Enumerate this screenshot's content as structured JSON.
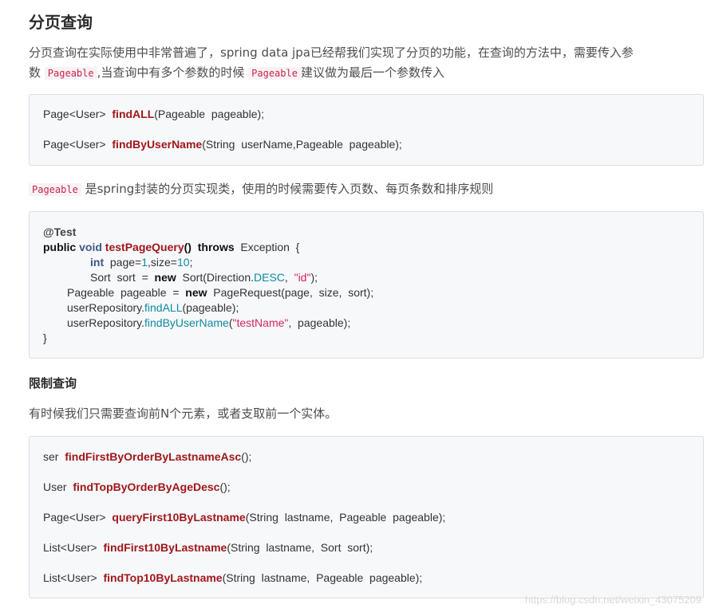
{
  "section1": {
    "title": "分页查询",
    "intro_part1": "分页查询在实际使用中非常普遍了，spring data jpa已经帮我们实现了分页的功能，在查询的方法中，需要传入参",
    "intro_part2_a": "数",
    "intro_code1": "Pageable",
    "intro_part2_b": ",当查询中有多个参数的时候",
    "intro_code2": "Pageable",
    "intro_part2_c": "建议做为最后一个参数传入"
  },
  "code1": {
    "line1": {
      "prefix": "Page<User>  ",
      "method": "findALL",
      "suffix": "(Pageable  pageable);"
    },
    "line2": {
      "prefix": "Page<User>  ",
      "method": "findByUserName",
      "suffix": "(String  userName,Pageable  pageable);"
    }
  },
  "pageable_desc": {
    "code": "Pageable",
    "text": " 是spring封装的分页实现类，使用的时候需要传入页数、每页条数和排序规则"
  },
  "code2": {
    "annotation": "@Test",
    "l2_public": "public",
    "l2_void": "void",
    "l2_method": "testPageQuery",
    "l2_paren": "()  ",
    "l2_throws": "throws",
    "l2_rest": "  Exception  {",
    "l3_int": "int",
    "l3_page": "  page=",
    "l3_one": "1",
    "l3_size": ",size=",
    "l3_ten": "10",
    "l3_end": ";",
    "l4_a": "Sort  sort  =  ",
    "l4_new": "new",
    "l4_b": "  Sort(Direction.",
    "l4_desc": "DESC",
    "l4_c": ",  ",
    "l4_id": "\"id\"",
    "l4_d": ");",
    "l5_a": "Pageable  pageable  =  ",
    "l5_new": "new",
    "l5_b": "  PageRequest(page,  size,  sort);",
    "l6_a": "userRepository.",
    "l6_m": "findALL",
    "l6_b": "(pageable);",
    "l7_a": "userRepository.",
    "l7_m": "findByUserName",
    "l7_b": "(",
    "l7_s": "\"testName\"",
    "l7_c": ",  pageable);",
    "l8": "}"
  },
  "section2": {
    "title": "限制查询",
    "text": "有时候我们只需要查询前N个元素，或者支取前一个实体。"
  },
  "code3": {
    "line1": {
      "prefix": "ser  ",
      "method": "findFirstByOrderByLastnameAsc",
      "suffix": "();"
    },
    "line2": {
      "prefix": "User  ",
      "method": "findTopByOrderByAgeDesc",
      "suffix": "();"
    },
    "line3": {
      "prefix": "Page<User>  ",
      "method": "queryFirst10ByLastname",
      "suffix": "(String  lastname,  Pageable  pageable);"
    },
    "line4": {
      "prefix": "List<User>  ",
      "method": "findFirst10ByLastname",
      "suffix": "(String  lastname,  Sort  sort);"
    },
    "line5": {
      "prefix": "List<User>  ",
      "method": "findTop10ByLastname",
      "suffix": "(String  lastname,  Pageable  pageable);"
    }
  },
  "watermark": "https://blog.csdn.net/weixin_43075209"
}
